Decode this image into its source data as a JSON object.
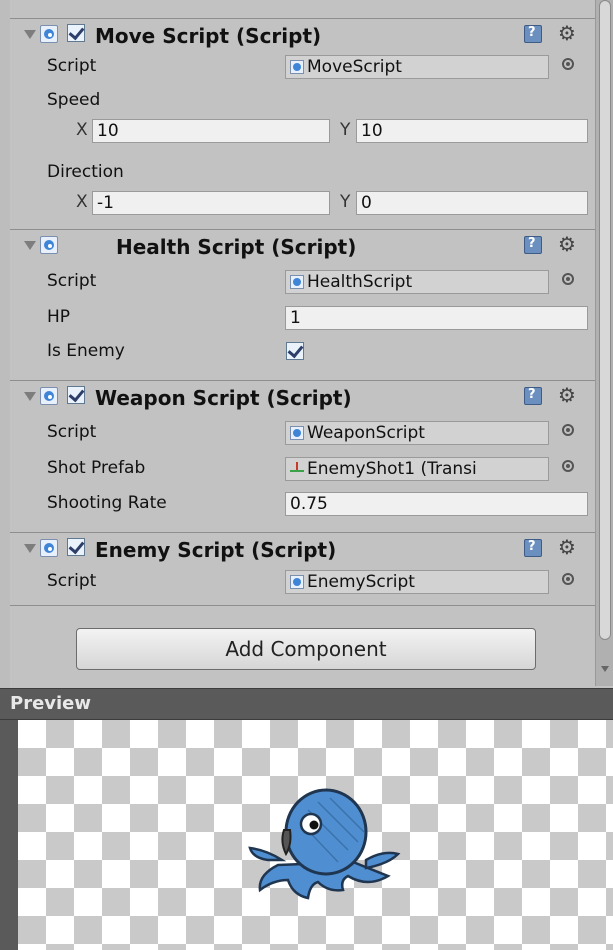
{
  "components": [
    {
      "title": "Move Script (Script)",
      "enabled": true,
      "fields": {
        "script_label": "Script",
        "script_value": "MoveScript",
        "speed_label": "Speed",
        "speed_x_label": "X",
        "speed_x": "10",
        "speed_y_label": "Y",
        "speed_y": "10",
        "direction_label": "Direction",
        "direction_x_label": "X",
        "direction_x": "-1",
        "direction_y_label": "Y",
        "direction_y": "0"
      }
    },
    {
      "title": "Health Script (Script)",
      "enabled": false,
      "fields": {
        "script_label": "Script",
        "script_value": "HealthScript",
        "hp_label": "HP",
        "hp_value": "1",
        "is_enemy_label": "Is Enemy",
        "is_enemy": true
      }
    },
    {
      "title": "Weapon Script (Script)",
      "enabled": true,
      "fields": {
        "script_label": "Script",
        "script_value": "WeaponScript",
        "shot_prefab_label": "Shot Prefab",
        "shot_prefab_value": "EnemyShot1 (Transi",
        "shooting_rate_label": "Shooting Rate",
        "shooting_rate_value": "0.75"
      }
    },
    {
      "title": "Enemy Script (Script)",
      "enabled": true,
      "fields": {
        "script_label": "Script",
        "script_value": "EnemyScript"
      }
    }
  ],
  "add_component_label": "Add Component",
  "preview": {
    "title": "Preview",
    "sprite": "octopus-enemy-sprite"
  },
  "colors": {
    "panel_bg": "#c2c2c2",
    "preview_bar": "#5a5a5a",
    "sprite_blue": "#4f8fd1"
  }
}
